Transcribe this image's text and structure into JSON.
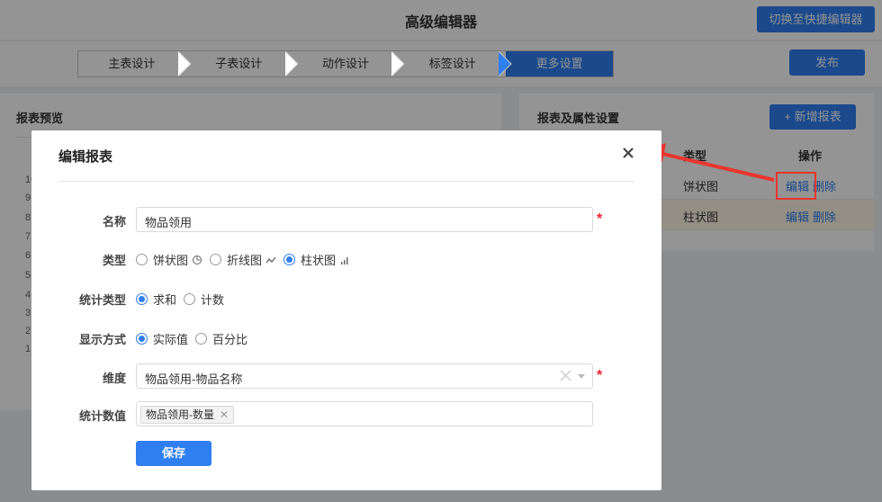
{
  "app": {
    "title": "高级编辑器",
    "switch_label": "切换至快捷编辑器",
    "publish_label": "发布"
  },
  "steps": [
    {
      "label": "主表设计",
      "active": false
    },
    {
      "label": "子表设计",
      "active": false
    },
    {
      "label": "动作设计",
      "active": false
    },
    {
      "label": "标签设计",
      "active": false
    },
    {
      "label": "更多设置",
      "active": true
    }
  ],
  "preview": {
    "title": "报表预览",
    "ticks": [
      "10",
      "9",
      "8",
      "7",
      "6",
      "5",
      "4",
      "3",
      "2",
      "1"
    ]
  },
  "reports": {
    "title": "报表及属性设置",
    "add_label": "+ 新增报表",
    "columns": {
      "type": "类型",
      "action": "操作"
    },
    "rows": [
      {
        "type": "饼状图",
        "edit": "编辑",
        "delete": "删除"
      },
      {
        "type": "柱状图",
        "edit": "编辑",
        "delete": "删除"
      }
    ]
  },
  "modal": {
    "title": "编辑报表",
    "name_label": "名称",
    "name_value": "物品领用",
    "type_label": "类型",
    "type_options": [
      {
        "label": "饼状图",
        "icon": "pie-chart-icon",
        "selected": false
      },
      {
        "label": "折线图",
        "icon": "line-chart-icon",
        "selected": false
      },
      {
        "label": "柱状图",
        "icon": "bar-chart-icon",
        "selected": true
      }
    ],
    "stat_type_label": "统计类型",
    "stat_type_options": [
      {
        "label": "求和",
        "selected": true
      },
      {
        "label": "计数",
        "selected": false
      }
    ],
    "display_label": "显示方式",
    "display_options": [
      {
        "label": "实际值",
        "selected": true
      },
      {
        "label": "百分比",
        "selected": false
      }
    ],
    "dimension_label": "维度",
    "dimension_value": "物品领用-物品名称",
    "measure_label": "统计数值",
    "measure_tag": "物品领用-数量",
    "save_label": "保存",
    "required_mark": "*"
  },
  "colors": {
    "accent": "#2f7ff0",
    "required": "#e23333",
    "annotation": "#e8362f"
  }
}
